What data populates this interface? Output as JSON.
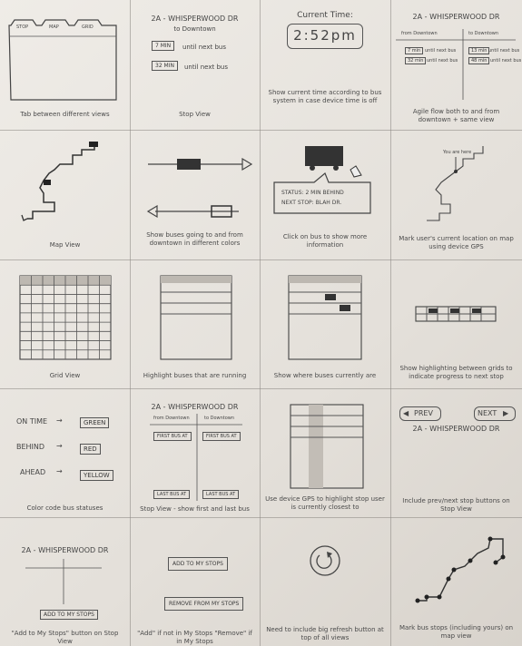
{
  "captions": {
    "c1": "Tab between different views",
    "c2": "Stop View",
    "c3": "Show current time according to bus system in case device time is off",
    "c4": "Agile flow both to and from downtown + same view",
    "c5": "Map View",
    "c6": "Show buses going to and from downtown in different colors",
    "c7": "Click on bus to show more information",
    "c8": "Mark user's current location on map using device GPS",
    "c9": "Grid View",
    "c10": "Highlight buses that are running",
    "c11": "Show where buses currently are",
    "c12": "Show highlighting between grids to indicate progress to next stop",
    "c13": "Color code bus statuses",
    "c14": "Stop View - show first and last bus",
    "c15": "Use device GPS to highlight stop user is currently closest to",
    "c16": "Include prev/next stop buttons on Stop View",
    "c17": "\"Add to My Stops\" button on Stop View",
    "c18": "\"Add\" if not in My Stops \"Remove\" if in My Stops",
    "c19": "Need to include big refresh button at top of all views",
    "c20": "Mark bus stops (including yours) on map view"
  },
  "tabs": [
    "STOP",
    "MAP",
    "GRID"
  ],
  "stop_view": {
    "title": "2A - WHISPERWOOD DR",
    "subtitle": "to Downtown",
    "row1_value": "7 MIN",
    "row1_text": "until next bus",
    "row2_value": "32 MIN",
    "row2_text": "until next bus"
  },
  "time_view": {
    "label": "Current Time:",
    "time": "2:52pm"
  },
  "dual_view": {
    "title": "2A - WHISPERWOOD DR",
    "left_head": "from Downtown",
    "right_head": "to Downtown",
    "l1": "7 min",
    "l1t": "until next bus",
    "l2": "32 min",
    "l2t": "until next bus",
    "r1": "13 min",
    "r1t": "until next bus",
    "r2": "48 min",
    "r2t": "until next bus"
  },
  "status_popup": {
    "line1": "STATUS: 2 MIN BEHIND",
    "line2": "NEXT STOP: BLAH DR."
  },
  "you_are_here": "You are here",
  "statuses": [
    {
      "label": "ON TIME",
      "badge": "GREEN"
    },
    {
      "label": "BEHIND",
      "badge": "RED"
    },
    {
      "label": "AHEAD",
      "badge": "YELLOW"
    }
  ],
  "first_last": {
    "title": "2A - WHISPERWOOD DR",
    "left_head": "from Downtown",
    "right_head": "to Downtown",
    "first_l": "FIRST BUS AT",
    "first_r": "FIRST BUS AT",
    "last_l": "LAST BUS AT",
    "last_r": "LAST BUS AT"
  },
  "prevnext": {
    "prev": "PREV",
    "next": "NEXT",
    "title": "2A - WHISPERWOOD DR"
  },
  "add_stop": {
    "title": "2A - WHISPERWOOD DR",
    "button": "ADD TO MY STOPS"
  },
  "add_remove": {
    "add": "ADD TO MY STOPS",
    "remove": "REMOVE FROM MY STOPS"
  },
  "colors": {
    "paper": "#ece8e2",
    "pencil": "#3a3a3a",
    "line": "#8a8782"
  }
}
